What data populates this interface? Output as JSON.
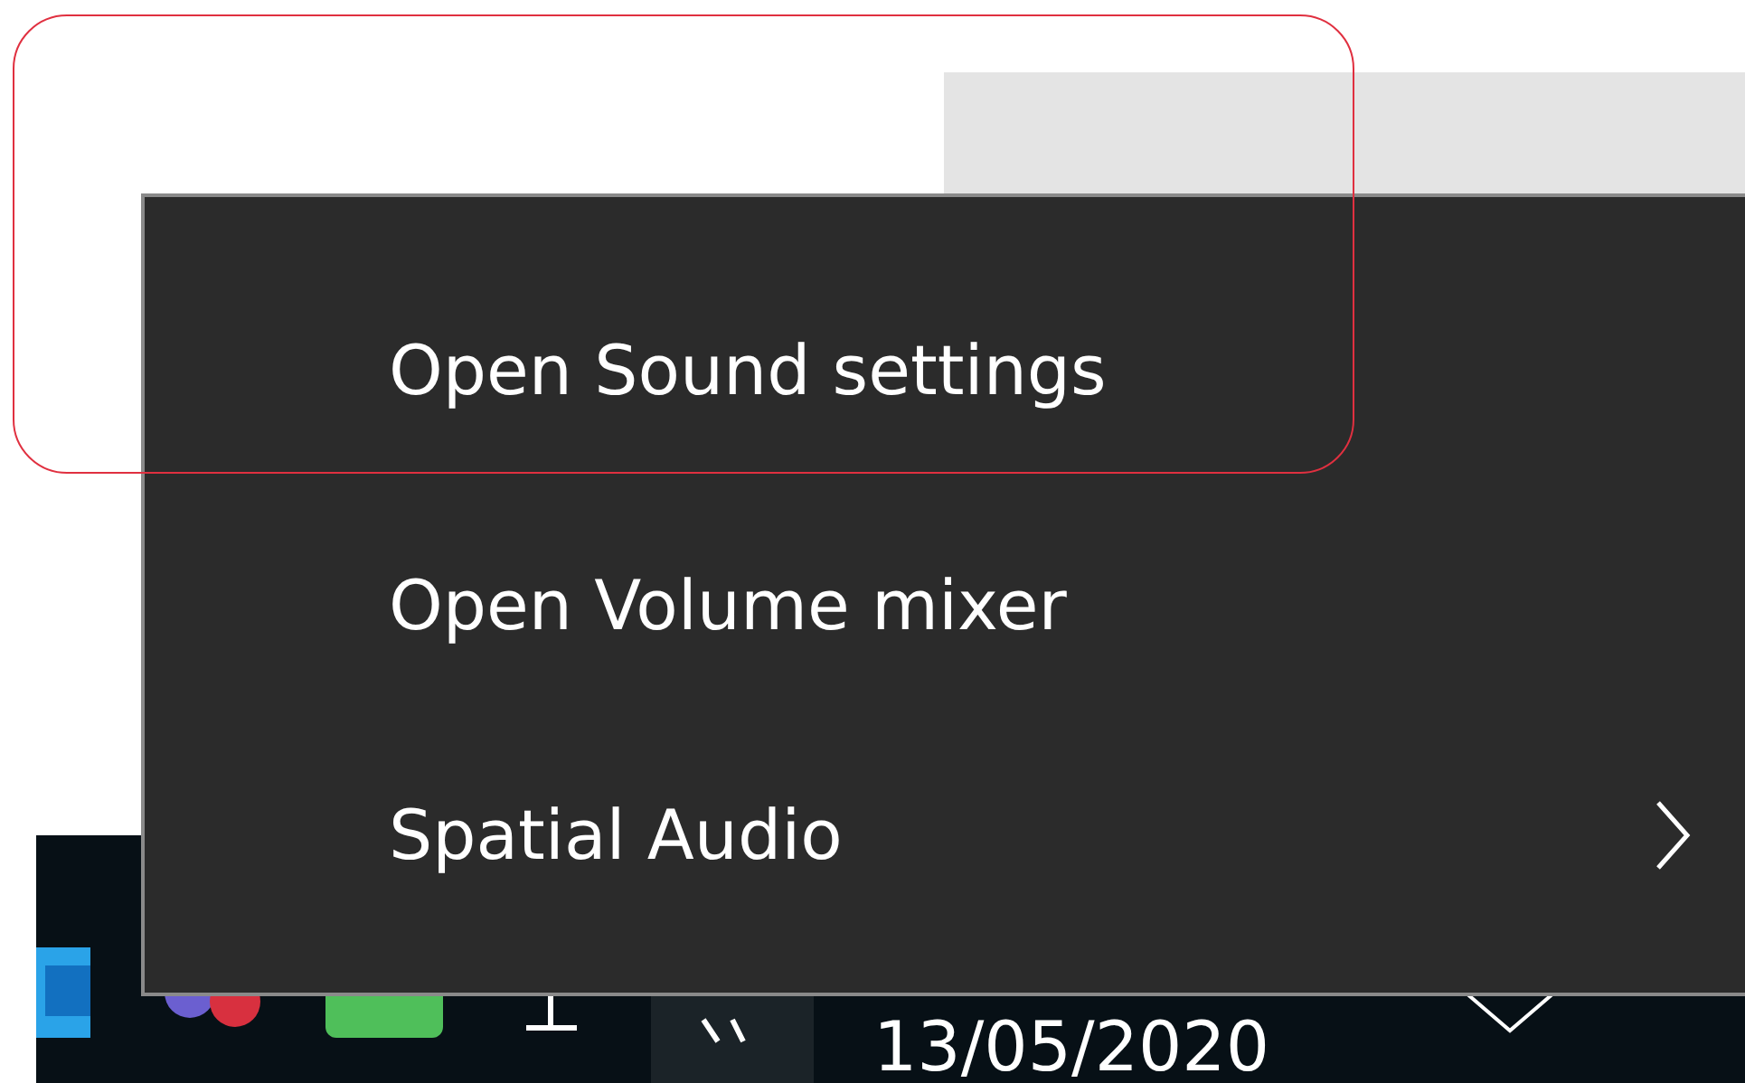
{
  "context_menu": {
    "items": [
      {
        "label": "Open Sound settings",
        "kind": "item"
      },
      {
        "label": "Open Volume mixer",
        "kind": "item"
      },
      {
        "label": "Spatial Audio",
        "kind": "submenu"
      }
    ]
  },
  "taskbar": {
    "date": "13/05/2020"
  }
}
